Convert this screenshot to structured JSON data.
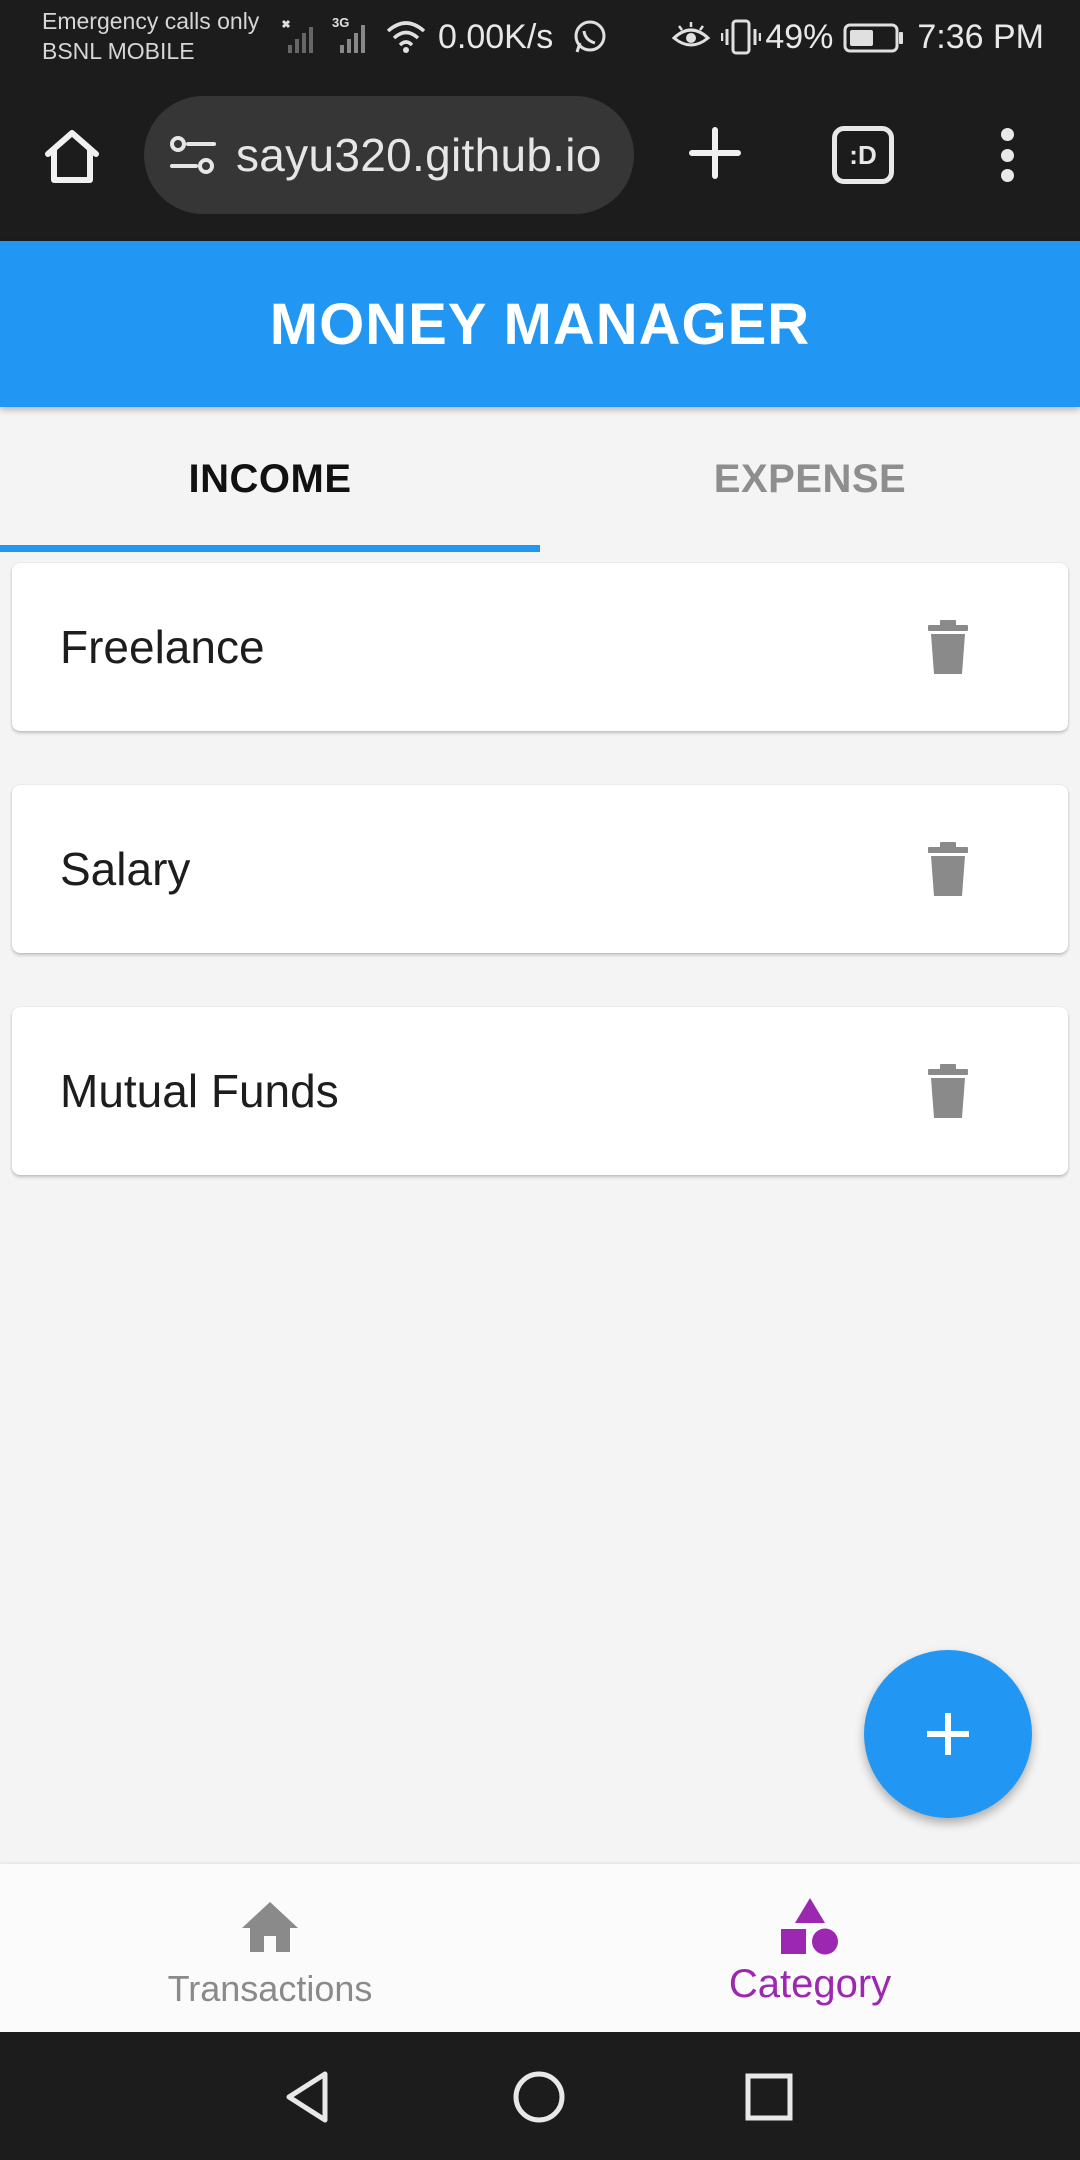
{
  "status_bar": {
    "carrier_line1": "Emergency calls only",
    "carrier_line2": "BSNL MOBILE",
    "network_type": "3G",
    "net_speed": "0.00K/s",
    "battery": "49%",
    "time": "7:36 PM",
    "icons": [
      "signal-no-sim-icon",
      "signal-3g-icon",
      "wifi-icon",
      "whatsapp-icon",
      "eye-comfort-icon",
      "vibrate-icon",
      "battery-icon"
    ]
  },
  "browser": {
    "url": "sayu320.github.io",
    "tab_button_label": ":D",
    "icons": [
      "home-icon",
      "site-settings-icon",
      "plus-icon",
      "tab-switcher-icon",
      "more-vert-icon"
    ]
  },
  "app": {
    "title": "MONEY MANAGER",
    "primary_color": "#2196f3",
    "accent_color": "#9c27b0"
  },
  "tabs": {
    "income": "INCOME",
    "expense": "EXPENSE",
    "selected": "INCOME"
  },
  "categories": [
    {
      "name": "Freelance"
    },
    {
      "name": "Salary"
    },
    {
      "name": "Mutual Funds"
    }
  ],
  "fab": {
    "icon": "plus-icon"
  },
  "bottom_nav": {
    "transactions": "Transactions",
    "category": "Category",
    "selected": "Category"
  },
  "system_nav": {
    "icons": [
      "back-icon",
      "home-circle-icon",
      "recents-icon"
    ]
  }
}
